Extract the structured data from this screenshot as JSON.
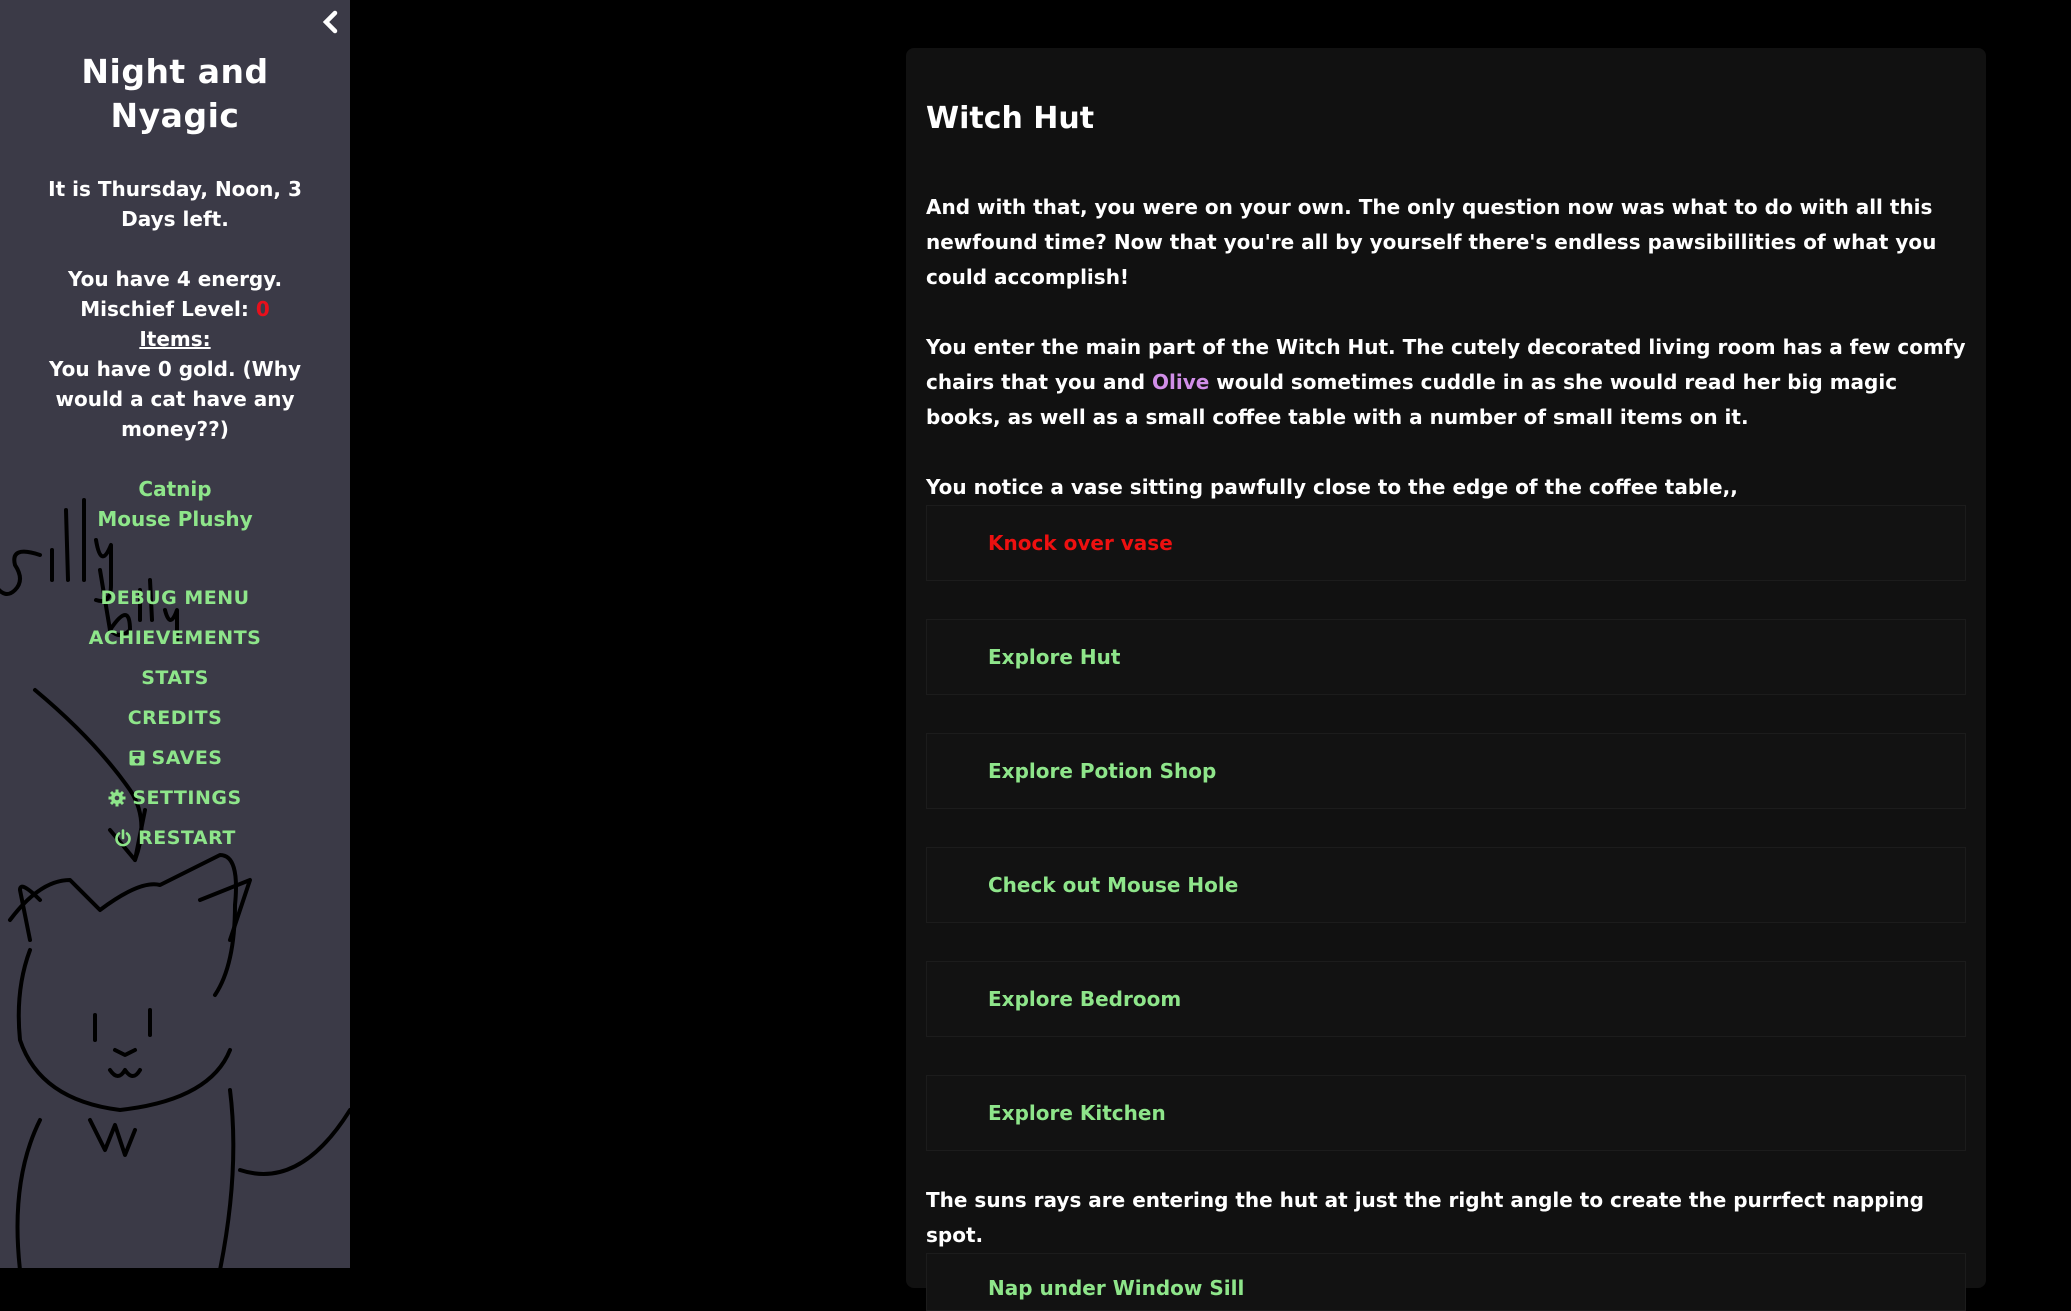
{
  "sidebar": {
    "title": "Night and Nyagic",
    "day_line": "It is Thursday, Noon, 3 Days left.",
    "energy_line": "You have 4 energy.",
    "mischief_label": "Mischief Level:",
    "mischief_value": "0",
    "items_label": "Items:",
    "gold_line": "You have 0 gold. (Why would a cat have any money??)",
    "items": [
      "Catnip",
      "Mouse Plushy"
    ],
    "menu": {
      "debug": "DEBUG MENU",
      "achievements": "ACHIEVEMENTS",
      "stats": "STATS",
      "credits": "CREDITS",
      "saves": "SAVES",
      "settings": "SETTINGS",
      "restart": "RESTART"
    },
    "doodle_text": "silly billy"
  },
  "passage": {
    "title": "Witch Hut",
    "para1": "And with that, you were on your own. The only question now was what to do with all this newfound time? Now that you're all by yourself there's endless pawsibillities of what you could accomplish!",
    "para2_a": "You enter the main part of the Witch Hut. The cutely decorated living room has a few comfy chairs that you and ",
    "para2_name": "Olive",
    "para2_b": " would sometimes cuddle in as she would read her big magic books, as well as a small coffee table with a number of small items on it.",
    "para3": "You notice a vase sitting pawfully close to the edge of the coffee table,,",
    "choices": {
      "knock": "Knock over vase",
      "hut": "Explore Hut",
      "potion": "Explore Potion Shop",
      "mouse": "Check out Mouse Hole",
      "bedroom": "Explore Bedroom",
      "kitchen": "Explore Kitchen",
      "nap": "Nap under Window Sill"
    },
    "para4": "The suns rays are entering the hut at just the right angle to create the purrfect napping spot."
  },
  "colors": {
    "sidebar_bg": "#3b3a47",
    "link_green": "#8ee58a",
    "danger_red": "#ee1010",
    "olive_purple": "#d18ee8",
    "panel_bg": "#111111"
  }
}
